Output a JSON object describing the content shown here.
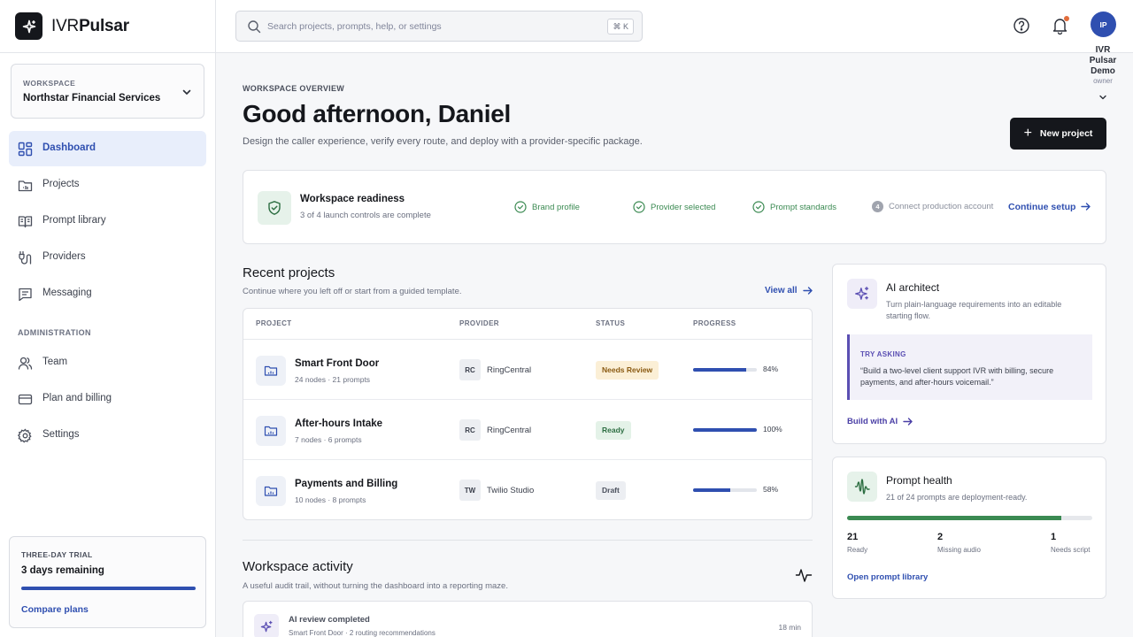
{
  "brand": {
    "name_light": "IVR",
    "name_bold": "Pulsar"
  },
  "workspace": {
    "label": "WORKSPACE",
    "name": "Northstar Financial Services"
  },
  "nav": {
    "items": [
      {
        "label": "Dashboard",
        "icon": "dashboard-icon",
        "active": true
      },
      {
        "label": "Projects",
        "icon": "folder-icon"
      },
      {
        "label": "Prompt library",
        "icon": "book-icon"
      },
      {
        "label": "Providers",
        "icon": "plug-icon"
      },
      {
        "label": "Messaging",
        "icon": "message-icon"
      }
    ],
    "admin_label": "ADMINISTRATION",
    "admin_items": [
      {
        "label": "Team",
        "icon": "users-icon"
      },
      {
        "label": "Plan and billing",
        "icon": "credit-card-icon"
      },
      {
        "label": "Settings",
        "icon": "gear-icon"
      }
    ]
  },
  "trial": {
    "label": "THREE-DAY TRIAL",
    "title": "3 days remaining",
    "progress": 1.0,
    "link": "Compare plans"
  },
  "search": {
    "placeholder": "Search projects, prompts, help, or settings",
    "shortcut": "⌘ K"
  },
  "user": {
    "initials": "IP",
    "name": "IVR Pulsar Demo",
    "role": "owner"
  },
  "header": {
    "eyebrow": "WORKSPACE OVERVIEW",
    "greeting": "Good afternoon, Daniel",
    "subtitle": "Design the caller experience, verify every route, and deploy with a provider-specific package.",
    "new_project": "New project"
  },
  "readiness": {
    "title": "Workspace readiness",
    "subtitle": "3 of 4 launch controls are complete",
    "steps": [
      {
        "label": "Brand profile",
        "done": true
      },
      {
        "label": "Provider selected",
        "done": true
      },
      {
        "label": "Prompt standards",
        "done": true
      },
      {
        "label": "Connect production account",
        "done": false,
        "number": "4"
      }
    ],
    "action": "Continue setup"
  },
  "recent": {
    "title": "Recent projects",
    "subtitle": "Continue where you left off or start from a guided template.",
    "view_all": "View all",
    "columns": [
      "PROJECT",
      "PROVIDER",
      "STATUS",
      "PROGRESS"
    ],
    "rows": [
      {
        "name": "Smart Front Door",
        "meta": "24 nodes · 21 prompts",
        "provider_abbr": "RC",
        "provider": "RingCentral",
        "status": "Needs Review",
        "status_kind": "review",
        "progress": 84,
        "progress_label": "84%"
      },
      {
        "name": "After-hours Intake",
        "meta": "7 nodes · 6 prompts",
        "provider_abbr": "RC",
        "provider": "RingCentral",
        "status": "Ready",
        "status_kind": "ready",
        "progress": 100,
        "progress_label": "100%"
      },
      {
        "name": "Payments and Billing",
        "meta": "10 nodes · 8 prompts",
        "provider_abbr": "TW",
        "provider": "Twilio Studio",
        "status": "Draft",
        "status_kind": "draft",
        "progress": 58,
        "progress_label": "58%"
      }
    ]
  },
  "activity": {
    "title": "Workspace activity",
    "subtitle": "A useful audit trail, without turning the dashboard into a reporting maze.",
    "items": [
      {
        "title": "AI review completed",
        "meta": "Smart Front Door · 2 routing recommendations",
        "time": "18 min"
      }
    ]
  },
  "ai_architect": {
    "title": "AI architect",
    "description": "Turn plain-language requirements into an editable starting flow.",
    "try_label": "TRY ASKING",
    "try_text": "“Build a two-level client support IVR with billing, secure payments, and after-hours voicemail.”",
    "link": "Build with AI"
  },
  "prompt_health": {
    "title": "Prompt health",
    "subtitle": "21 of 24 prompts are deployment-ready.",
    "ready_fraction": 0.875,
    "stats": [
      {
        "value": "21",
        "label": "Ready"
      },
      {
        "value": "2",
        "label": "Missing audio"
      },
      {
        "value": "1",
        "label": "Needs script"
      }
    ],
    "link": "Open prompt library"
  },
  "colors": {
    "accent": "#2f4fb0",
    "success": "#3b8a52",
    "ai": "#5b4fb3",
    "dark": "#15171c"
  }
}
